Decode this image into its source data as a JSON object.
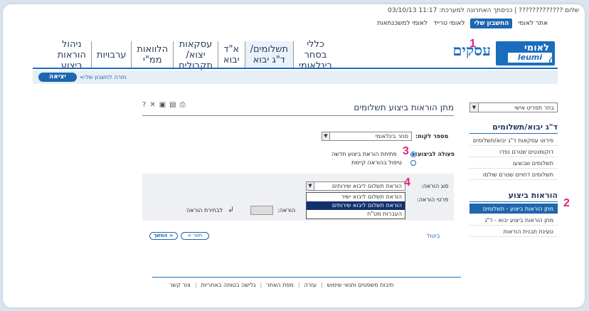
{
  "toplinks": [
    "אתר לאומי",
    "החשבון שלי",
    "לאומי טרייד",
    "לאומי למשכנתאות"
  ],
  "logo": {
    "hebrew": "לאומי",
    "latin": "leumi"
  },
  "brand": "עסקים",
  "mainnav": [
    "כללי בסחר בינלאומי",
    "תשלומים/ ד\"ג יבוא",
    "א\"ד יבוא",
    "עסקאות יצוא/ תקבולים",
    "הלוואות ממ\"י",
    "ערבויות",
    "ניהול הוראות ביצוע"
  ],
  "status": {
    "text": "שלום ????????????? | כניסתך האחרונה למערכת: 11:17 03/10/13",
    "exit": "יציאה",
    "back": "חזרה לחשבון שלי>"
  },
  "sidebar": {
    "select_placeholder": "בחר תפריט אישי",
    "section1_title": "ד\"ג יבוא/תשלומים",
    "section1_items": [
      "פירוט עסקאות ד\"ג יבוא/תשלומים",
      "דוקומנטים שטרם נפדו",
      "תשלומים שבוצעו",
      "תשלומים דחויים שטרם שולמו"
    ],
    "section2_title": "הוראות ביצוע",
    "section2_items": [
      "מתן הוראות ביצוע - תשלומים",
      "מתן הוראות ביצוע יבוא - ד\"ג",
      "טעינת תבנית הוראות"
    ]
  },
  "content": {
    "title": "מתן הוראות ביצוע תשלומים",
    "customer_label": "מספר לקוח:",
    "customer_value": "סחר בינלאומי",
    "action_label": "פעולה לביצוע:",
    "action_new": "פתיחת הוראת ביצוע חדשה",
    "action_existing": "טיפול בהוראה קיימת",
    "type_label": "סוג הוראה:",
    "type_value": "הוראת תשלום ליבוא שירותים",
    "details_label": "פרטי הוראה:",
    "instruction_label": "הוראה:",
    "choose_link": "לבחירת הוראה",
    "dropdown_options": [
      "הוראת תשלום ליבוא ישיר",
      "הוראת תשלום ליבוא שירותים",
      "העברות מט\"ח"
    ],
    "cancel": "ביטול",
    "back_btn": "< חזור",
    "continue_btn": "המשך >"
  },
  "callouts": [
    "1",
    "2",
    "3",
    "4"
  ],
  "footer": [
    "תיבות משפטים ותנאי שימוש",
    "עזרה",
    "מפת האתר",
    "גלישה בטוחה באחריות",
    "צור קשר"
  ],
  "colors": {
    "brand_blue": "#1a6dbd",
    "callout_pink": "#e0207f",
    "highlight_navy": "#13306e"
  }
}
